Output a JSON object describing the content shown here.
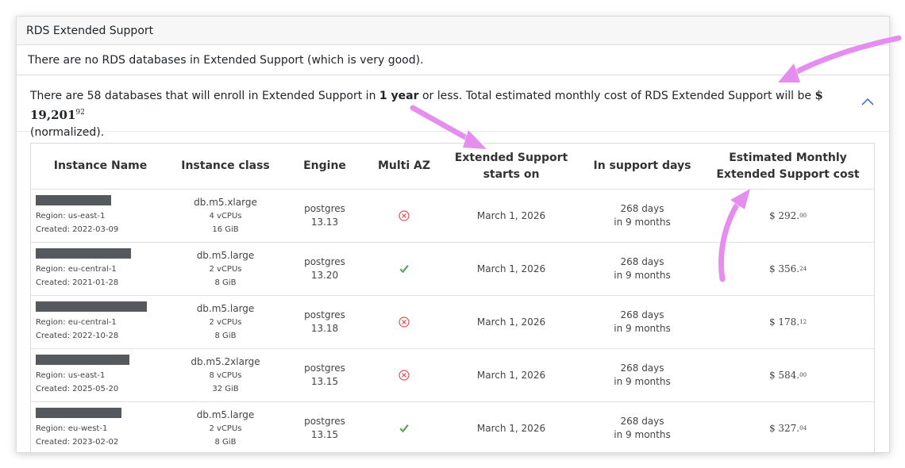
{
  "card_title": "RDS Extended Support",
  "none_message": "There are no RDS databases in Extended Support (which is very good).",
  "summary": {
    "part1": "There are 58 databases that will enroll in Extended Support in ",
    "bold_period": "1 year",
    "part2": " or less. Total estimated monthly cost of RDS Extended Support will be ",
    "total_main": "$ 19,201",
    "total_cents": "92",
    "part3": "(normalized)."
  },
  "table": {
    "headers": {
      "name": "Instance Name",
      "class": "Instance class",
      "engine": "Engine",
      "multiaz": "Multi AZ",
      "starts_line1": "Extended Support",
      "starts_line2": "starts on",
      "days": "In support days",
      "cost_line1": "Estimated Monthly",
      "cost_line2": "Extended Support cost"
    },
    "rows": [
      {
        "region": "Region: us-east-1",
        "created": "Created: 2022-03-09",
        "class": "db.m5.xlarge",
        "vcpu": "4 vCPUs",
        "mem": "16 GiB",
        "engine": "postgres",
        "version": "13.13",
        "multi_az": false,
        "starts": "March 1, 2026",
        "days": "268 days",
        "months": "in 9 months",
        "cost": "$ 292.",
        "cents": "00"
      },
      {
        "region": "Region: eu-central-1",
        "created": "Created: 2021-01-28",
        "class": "db.m5.large",
        "vcpu": "2 vCPUs",
        "mem": "8 GiB",
        "engine": "postgres",
        "version": "13.20",
        "multi_az": true,
        "starts": "March 1, 2026",
        "days": "268 days",
        "months": "in 9 months",
        "cost": "$ 356.",
        "cents": "24"
      },
      {
        "region": "Region: eu-central-1",
        "created": "Created: 2022-10-28",
        "class": "db.m5.large",
        "vcpu": "2 vCPUs",
        "mem": "8 GiB",
        "engine": "postgres",
        "version": "13.18",
        "multi_az": false,
        "starts": "March 1, 2026",
        "days": "268 days",
        "months": "in 9 months",
        "cost": "$ 178.",
        "cents": "12"
      },
      {
        "region": "Region: us-east-1",
        "created": "Created: 2025-05-20",
        "class": "db.m5.2xlarge",
        "vcpu": "8 vCPUs",
        "mem": "32 GiB",
        "engine": "postgres",
        "version": "13.15",
        "multi_az": false,
        "starts": "March 1, 2026",
        "days": "268 days",
        "months": "in 9 months",
        "cost": "$ 584.",
        "cents": "00"
      },
      {
        "region": "Region: eu-west-1",
        "created": "Created: 2023-02-02",
        "class": "db.m5.large",
        "vcpu": "2 vCPUs",
        "mem": "8 GiB",
        "engine": "postgres",
        "version": "13.15",
        "multi_az": true,
        "starts": "March 1, 2026",
        "days": "268 days",
        "months": "in 9 months",
        "cost": "$ 327.",
        "cents": "04"
      }
    ]
  },
  "colors": {
    "no_icon": "#e05252",
    "yes_icon": "#3a9a3a",
    "arrow": "#e58ef0"
  }
}
